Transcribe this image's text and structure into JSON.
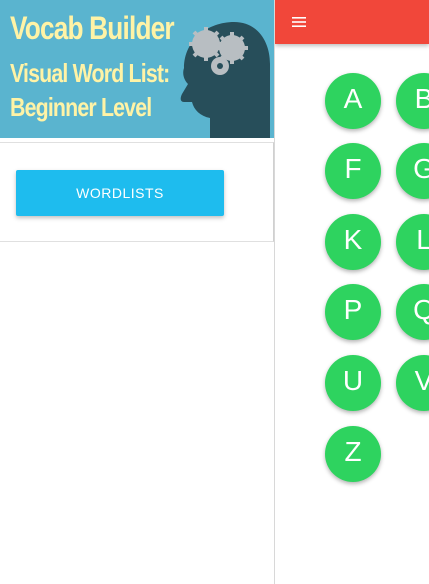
{
  "drawer": {
    "header": {
      "title_line1": "Vocab Builder",
      "title_line2": "Visual Word List:",
      "title_line3": "Beginner Level"
    },
    "wordlists_button": "WORDLISTS"
  },
  "toolbar": {
    "menu_icon": "hamburger-menu-icon",
    "color": "#f1473a"
  },
  "letters": {
    "a": "A",
    "b": "B",
    "f": "F",
    "g": "G",
    "k": "K",
    "l": "L",
    "p": "P",
    "q": "Q",
    "u": "U",
    "v": "V",
    "z": "Z"
  },
  "colors": {
    "header_bg": "#5ab4cf",
    "title_text": "#fff3a6",
    "button": "#1ebcee",
    "letter_circle": "#2ed35f"
  }
}
